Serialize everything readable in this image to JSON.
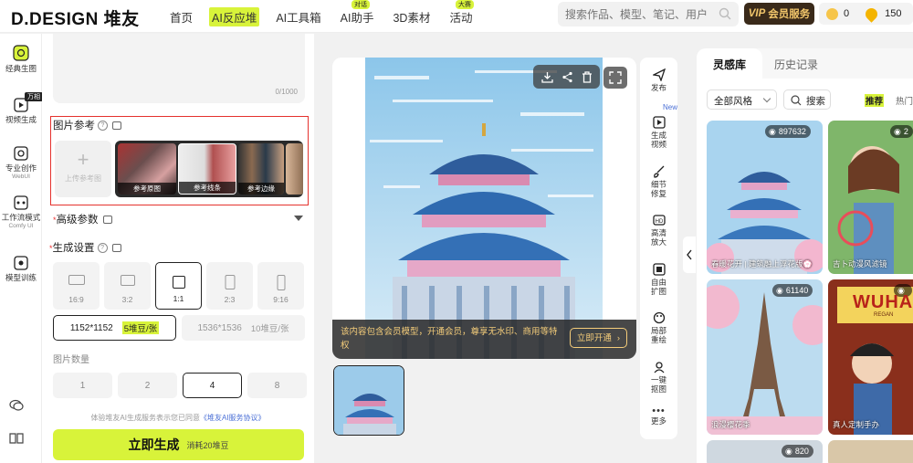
{
  "header": {
    "logo": "D.DESIGN 堆友",
    "nav": [
      {
        "label": "首页",
        "badge": ""
      },
      {
        "label": "AI反应堆",
        "badge": ""
      },
      {
        "label": "AI工具箱",
        "badge": ""
      },
      {
        "label": "AI助手",
        "badge": "对话"
      },
      {
        "label": "3D素材",
        "badge": ""
      },
      {
        "label": "活动",
        "badge": "大赛"
      }
    ],
    "search_placeholder": "搜索作品、模型、笔记、用户",
    "vip_tag": "VIP",
    "vip_label": "会员服务",
    "coins": "0",
    "beans": "150"
  },
  "rail": {
    "items": [
      {
        "label": "经典生图",
        "sub": ""
      },
      {
        "label": "视频生成",
        "sub": "",
        "badge": "万相"
      },
      {
        "label": "专业创作",
        "sub": "WebUI"
      },
      {
        "label": "工作流模式",
        "sub": "Comfy UI"
      },
      {
        "label": "模型训练",
        "sub": ""
      }
    ]
  },
  "panel": {
    "prompt_count": "0/1000",
    "ref_title": "图片参考",
    "upload_label": "上传参考图",
    "ref_thumbs": [
      "参考原图",
      "参考线条",
      "参考边缘"
    ],
    "advanced_title": "高级参数",
    "settings_title": "生成设置",
    "ratios": [
      "16:9",
      "3:2",
      "1:1",
      "2:3",
      "9:16"
    ],
    "ratio_selected": "1:1",
    "resolutions": [
      {
        "size": "1152*1152",
        "cost": "5堆豆/张"
      },
      {
        "size": "1536*1536",
        "cost": "10堆豆/张"
      }
    ],
    "count_label": "图片数量",
    "counts": [
      "1",
      "2",
      "4",
      "8"
    ],
    "count_selected": "4",
    "agree_text": "体验堆友AI生成服务表示您已同意",
    "agree_link": "《堆友AI服务协议》",
    "generate_label": "立即生成",
    "generate_cost": "消耗20堆豆"
  },
  "preview": {
    "promo_text": "该内容包含会员模型，开通会员，尊享无水印、商用等特权",
    "promo_button": "立即开通"
  },
  "tools": [
    {
      "label": "发布"
    },
    {
      "label": "生成视频",
      "badge": "New"
    },
    {
      "label": "细节修复"
    },
    {
      "label": "高清放大"
    },
    {
      "label": "自由扩图"
    },
    {
      "label": "局部重绘"
    },
    {
      "label": "一键抠图"
    },
    {
      "label": "更多"
    }
  ],
  "inspiration": {
    "tabs": [
      "灵感库",
      "历史记录"
    ],
    "style_select": "全部风格",
    "search_label": "搜索",
    "sort": [
      "推荐",
      "热门"
    ],
    "cards": [
      {
        "count": "897632",
        "title": "春暖花开 | 建筑融上浮花版💮"
      },
      {
        "count": "2",
        "title": "吉卜动漫风滤镜"
      },
      {
        "count": "61140",
        "title": "浪漫樱花季"
      },
      {
        "count": "",
        "title": "真人定制手办",
        "poster": "WUHA",
        "poster_sub": "REGAN"
      },
      {
        "count": "820",
        "title": ""
      }
    ]
  }
}
